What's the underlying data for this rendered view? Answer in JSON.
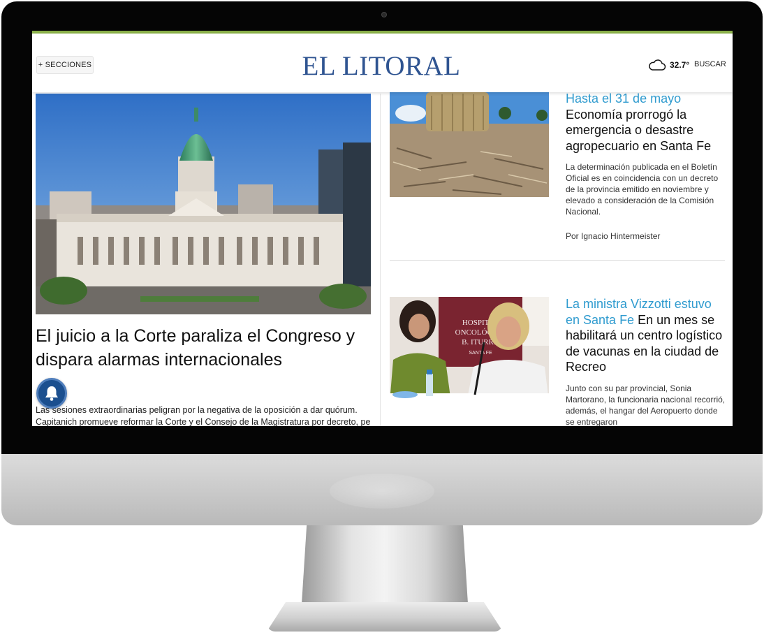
{
  "header": {
    "sections_label": "+ SECCIONES",
    "logo": "EL LITORAL",
    "temperature": "32.7°",
    "search_label": "BUSCAR",
    "weather_icon": "cloud-icon",
    "accent_color": "#8ab04a",
    "logo_color": "#2f5491"
  },
  "main_story": {
    "title": "El juicio a la Corte paraliza el Congreso y dispara alarmas internacionales",
    "summary": [
      "Las sesiones extraordinarias peligran por la negativa de la oposición a dar quórum.",
      "Capitanich promueve reformar la Corte y el Consejo de la Magistratura por decreto, pero"
    ],
    "image": "congress-building-photo"
  },
  "notifications": {
    "icon": "bell-icon"
  },
  "side_stories": [
    {
      "kicker": "Hasta el 31 de mayo",
      "title": "Economía prorrogó la emergencia o desastre agropecuario en Santa Fe",
      "summary": "La determinación publicada en el Boletín Oficial es en coincidencia con un decreto de la provincia emitido en noviembre y elevado a consideración de la Comisión Nacional.",
      "author": "Por Ignacio Hintermeister",
      "image": "dry-field-hay-bale-photo"
    },
    {
      "kicker": "La ministra Vizzotti estuvo en Santa Fe",
      "title": "En un mes se habilitará un centro logístico de vacunas en la ciudad de Recreo",
      "summary": "Junto con su par provincial, Sonia Martorano, la funcionaria nacional recorrió, además, el hangar del Aeropuerto donde se entregaron",
      "image": "press-conference-photo",
      "banner_lines": [
        "HOSPITAL",
        "ONCOLÓGICO",
        "B. ITURRA",
        "SANTA FE"
      ]
    }
  ],
  "colors": {
    "kicker": "#2f9bcf",
    "notification": "#1b4f8f"
  }
}
